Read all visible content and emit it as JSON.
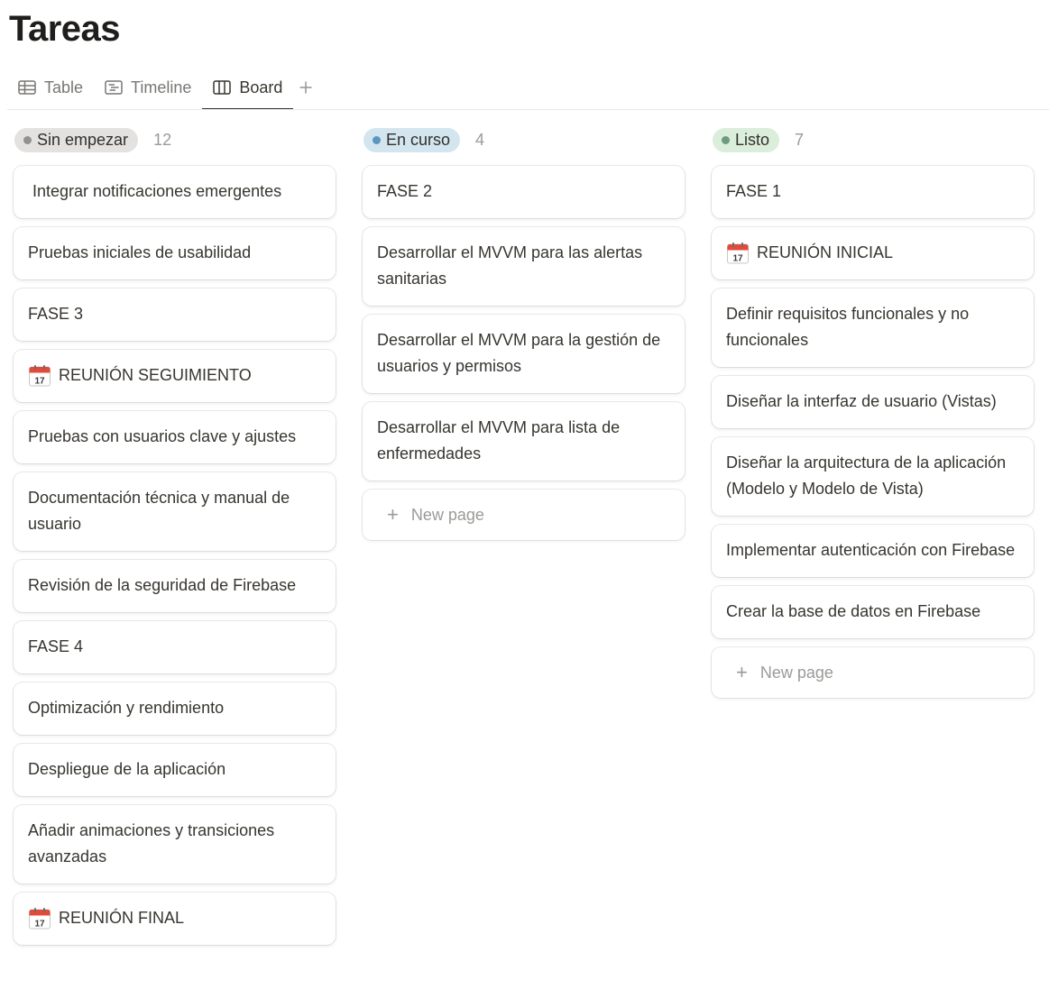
{
  "title": "Tareas",
  "views": {
    "table": "Table",
    "timeline": "Timeline",
    "board": "Board",
    "add_icon": "plus-icon"
  },
  "colors": {
    "sin_empezar_bg": "#e3e2e0",
    "sin_empezar_dot": "#91918e",
    "en_curso_bg": "#d3e5ef",
    "en_curso_dot": "#5b97bd",
    "listo_bg": "#dbeddb",
    "listo_dot": "#6c9b7d",
    "active_tab": "#37352f"
  },
  "new_page_label": "New page",
  "columns": [
    {
      "status": "Sin empezar",
      "count": "12",
      "cards": [
        " Integrar notificaciones emergentes",
        "Pruebas iniciales de usabilidad",
        "FASE 3",
        "REUNIÓN SEGUIMIENTO",
        "Pruebas con usuarios clave y ajustes",
        "Documentación técnica y manual de usuario",
        "Revisión de la seguridad de Firebase",
        "FASE 4",
        "Optimización y rendimiento",
        "Despliegue de la aplicación",
        "Añadir animaciones y transiciones avanzadas",
        "REUNIÓN FINAL"
      ]
    },
    {
      "status": "En curso",
      "count": "4",
      "cards": [
        "FASE 2",
        "Desarrollar el MVVM para las alertas sanitarias",
        "Desarrollar el MVVM para la gestión de usuarios y permisos",
        "Desarrollar el MVVM para lista de enfermedades"
      ]
    },
    {
      "status": "Listo",
      "count": "7",
      "cards": [
        "FASE 1",
        "REUNIÓN INICIAL",
        "Definir requisitos funcionales y no funcionales",
        "Diseñar la interfaz de usuario (Vistas)",
        "Diseñar la arquitectura de la aplicación (Modelo y Modelo de Vista)",
        "Implementar autenticación con Firebase",
        "Crear la base de datos en Firebase"
      ]
    }
  ]
}
